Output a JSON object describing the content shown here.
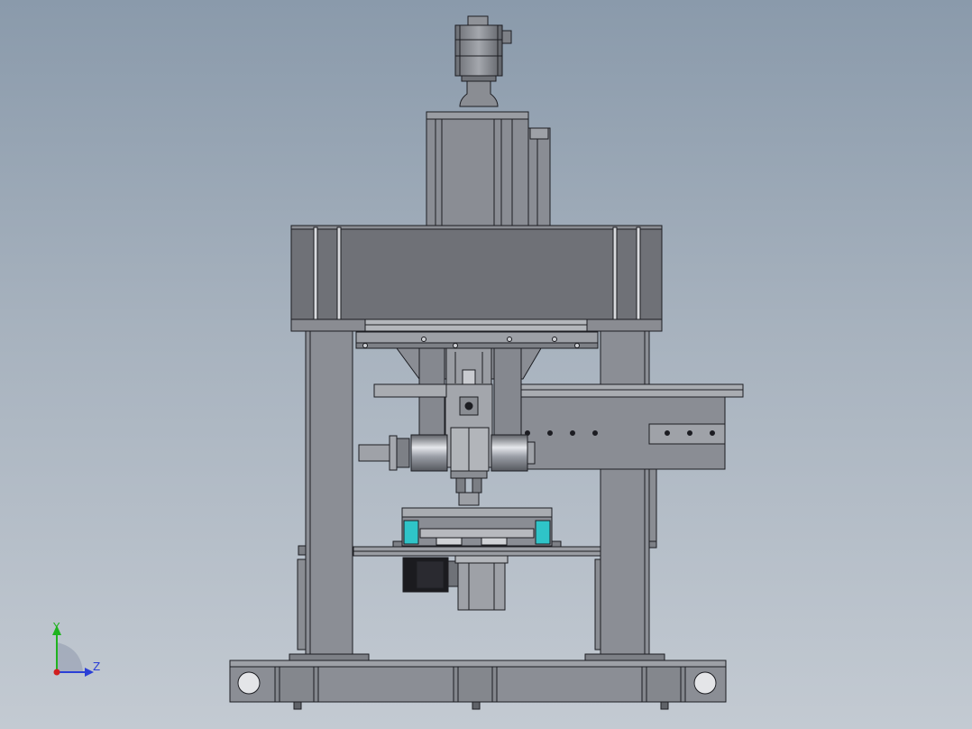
{
  "viewport": {
    "background_top": "#8a9aab",
    "background_bottom": "#c3cad2"
  },
  "model": {
    "metal_color": "#7c7f86",
    "frame_color": "#8c8f96",
    "dark_color": "#6e7076",
    "line_color": "#1c1d22",
    "accent_cyan": "#2fc4c8",
    "motor_black": "#1b1b1f"
  },
  "triad": {
    "y_label": "Y",
    "z_label": "Z",
    "y_color": "#1fb31f",
    "z_color": "#2b3fd6",
    "origin_color": "#d11f1f"
  }
}
